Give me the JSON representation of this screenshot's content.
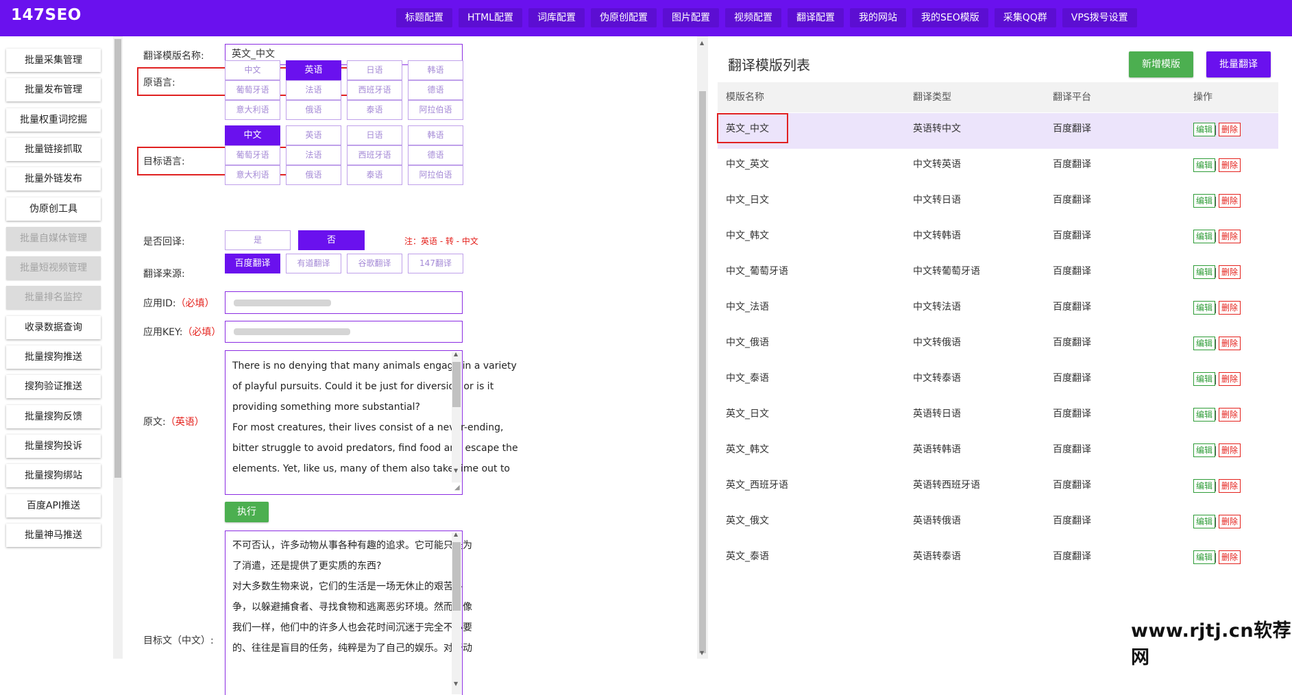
{
  "app": {
    "logo": "147SEO"
  },
  "nav": [
    "标题配置",
    "HTML配置",
    "词库配置",
    "伪原创配置",
    "图片配置",
    "视频配置",
    "翻译配置",
    "我的网站",
    "我的SEO模版",
    "采集QQ群",
    "VPS拨号设置"
  ],
  "sidebar": [
    {
      "label": "批量采集管理",
      "disabled": false
    },
    {
      "label": "批量发布管理",
      "disabled": false
    },
    {
      "label": "批量权重词挖掘",
      "disabled": false
    },
    {
      "label": "批量链接抓取",
      "disabled": false
    },
    {
      "label": "批量外链发布",
      "disabled": false
    },
    {
      "label": "伪原创工具",
      "disabled": false
    },
    {
      "label": "批量自媒体管理",
      "disabled": true
    },
    {
      "label": "批量短视频管理",
      "disabled": true
    },
    {
      "label": "批量排名监控",
      "disabled": true
    },
    {
      "label": "收录数据查询",
      "disabled": false
    },
    {
      "label": "批量搜狗推送",
      "disabled": false
    },
    {
      "label": "搜狗验证推送",
      "disabled": false
    },
    {
      "label": "批量搜狗反馈",
      "disabled": false
    },
    {
      "label": "批量搜狗投诉",
      "disabled": false
    },
    {
      "label": "批量搜狗绑站",
      "disabled": false
    },
    {
      "label": "百度API推送",
      "disabled": false
    },
    {
      "label": "批量神马推送",
      "disabled": false
    }
  ],
  "form": {
    "name_label": "翻译模版名称:",
    "name_value": "英文_中文",
    "source_lang_label": "原语言:",
    "target_lang_label": "目标语言:",
    "languages": [
      "中文",
      "英语",
      "日语",
      "韩语",
      "葡萄牙语",
      "法语",
      "西班牙语",
      "德语",
      "意大利语",
      "俄语",
      "泰语",
      "阿拉伯语"
    ],
    "source_selected": "英语",
    "target_selected": "中文",
    "back_translate_label": "是否回译:",
    "back_yes": "是",
    "back_no": "否",
    "back_note": "注：英语 - 转 - 中文",
    "source_label": "翻译来源:",
    "engines": [
      "百度翻译",
      "有道翻译",
      "谷歌翻译",
      "147翻译"
    ],
    "engine_selected": "百度翻译",
    "app_id_label": "应用ID:",
    "app_key_label": "应用KEY:",
    "required": "（必填）",
    "orig_label": "原文:",
    "orig_lang": "（英语）",
    "orig_lines": [
      "There is no denying that many animals engage in a variety",
      "of playful pursuits. Could it be just for diversion or is it",
      "providing something more substantial?",
      "For most creatures, their lives consist of a never-ending,",
      "bitter struggle to avoid predators, find food and escape the",
      "elements. Yet, like us, many of them also take time out to"
    ],
    "run_button": "执行",
    "target_label": "目标文（中文）:",
    "target_lines": [
      "不可否认，许多动物从事各种有趣的追求。它可能只是为",
      "了消遣，还是提供了更实质的东西?",
      "对大多数生物来说，它们的生活是一场无休止的艰苦斗",
      "争，以躲避捕食者、寻找食物和逃离恶劣环境。然而，像",
      "我们一样，他们中的许多人也会花时间沉迷于完全不必要",
      "的、往往是盲目的任务，纯粹是为了自己的娱乐。对于动"
    ]
  },
  "list": {
    "title": "翻译模版列表",
    "add_button": "新增模版",
    "batch_button": "批量翻译",
    "headers": [
      "模版名称",
      "翻译类型",
      "翻译平台",
      "操作"
    ],
    "edit_label": "编辑",
    "delete_label": "删除",
    "rows": [
      [
        "英文_中文",
        "英语转中文",
        "百度翻译"
      ],
      [
        "中文_英文",
        "中文转英语",
        "百度翻译"
      ],
      [
        "中文_日文",
        "中文转日语",
        "百度翻译"
      ],
      [
        "中文_韩文",
        "中文转韩语",
        "百度翻译"
      ],
      [
        "中文_葡萄牙语",
        "中文转葡萄牙语",
        "百度翻译"
      ],
      [
        "中文_法语",
        "中文转法语",
        "百度翻译"
      ],
      [
        "中文_俄语",
        "中文转俄语",
        "百度翻译"
      ],
      [
        "中文_泰语",
        "中文转泰语",
        "百度翻译"
      ],
      [
        "英文_日文",
        "英语转日语",
        "百度翻译"
      ],
      [
        "英文_韩文",
        "英语转韩语",
        "百度翻译"
      ],
      [
        "英文_西班牙语",
        "英语转西班牙语",
        "百度翻译"
      ],
      [
        "英文_俄文",
        "英语转俄语",
        "百度翻译"
      ],
      [
        "英文_泰语",
        "英语转泰语",
        "百度翻译"
      ]
    ]
  },
  "watermark": "www.rjtj.cn软荐网",
  "colors": {
    "brand": "#6a11ee",
    "green": "#4caf50",
    "danger": "#e4201b",
    "highlight_row": "#ece4fb"
  }
}
